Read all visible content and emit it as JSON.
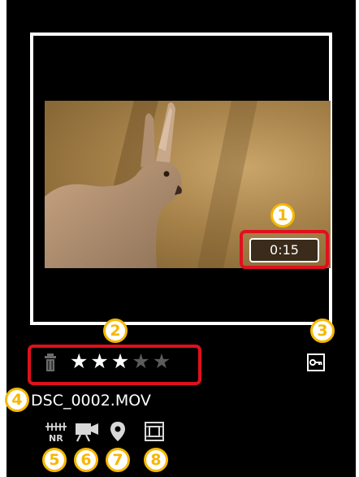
{
  "video": {
    "duration": "0:15",
    "filename": "DSC_0002.MOV"
  },
  "rating": {
    "stars": 3,
    "max": 5
  },
  "icons": {
    "delete": "trash-icon",
    "protect": "key-icon",
    "noise_reduction": "nr-icon",
    "movie": "movie-camera-icon",
    "location": "location-pin-icon",
    "crop": "crop-frame-icon"
  },
  "callouts": {
    "duration": "1",
    "rating": "2",
    "protect": "3",
    "filename": "4",
    "noise_reduction": "5",
    "movie": "6",
    "location": "7",
    "crop": "8"
  },
  "colors": {
    "callout_red": "#e0101c",
    "callout_number": "#f5b800",
    "background": "#000000",
    "star_filled": "#ffffff",
    "star_empty": "#5b5b5b"
  }
}
